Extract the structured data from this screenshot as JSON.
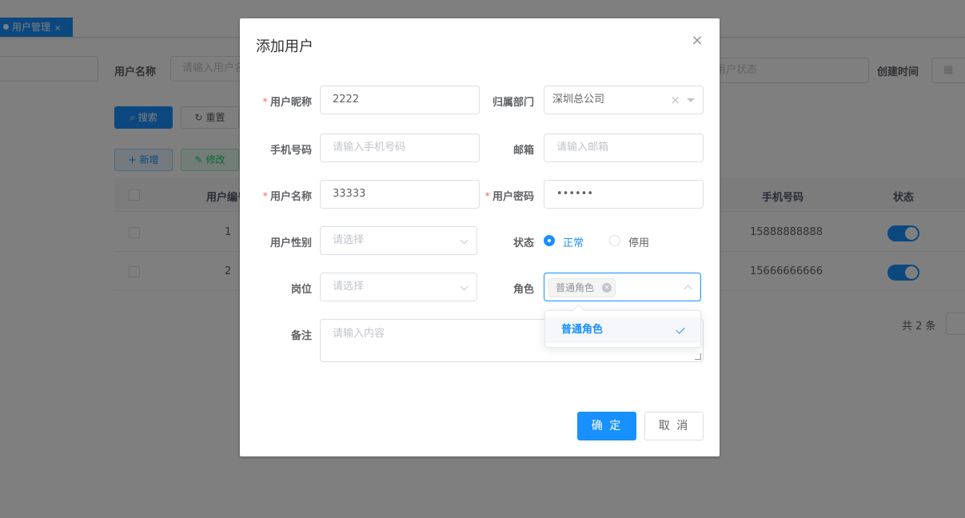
{
  "tags": {
    "active_label": "用户管理",
    "close": "×"
  },
  "query": {
    "username_label": "用户名称",
    "username_placeholder": "请输入用户名称",
    "status_placeholder": "用户状态",
    "created_label": "创建时间",
    "search_btn": "搜索",
    "reset_btn": "重置"
  },
  "toolbar": {
    "add_btn": "新增",
    "edit_btn": "修改"
  },
  "table": {
    "headers": {
      "id": "用户编号",
      "phone": "手机号码",
      "status": "状态"
    },
    "rows": [
      {
        "id": "1",
        "phone": "15888888888",
        "status_on": true
      },
      {
        "id": "2",
        "phone": "15666666666",
        "status_on": true
      }
    ]
  },
  "pagination": {
    "total": "共 2 条"
  },
  "dialog": {
    "title": "添加用户",
    "close_icon": "×",
    "fields": {
      "nickname": {
        "label": "用户昵称",
        "value": "2222",
        "required": true
      },
      "dept": {
        "label": "归属部门",
        "value": "深圳总公司"
      },
      "phone": {
        "label": "手机号码",
        "placeholder": "请输入手机号码"
      },
      "email": {
        "label": "邮箱",
        "placeholder": "请输入邮箱"
      },
      "username": {
        "label": "用户名称",
        "value": "33333",
        "required": true
      },
      "password": {
        "label": "用户密码",
        "value": "••••••",
        "required": true
      },
      "gender": {
        "label": "用户性别",
        "placeholder": "请选择"
      },
      "status": {
        "label": "状态",
        "options": [
          "正常",
          "停用"
        ],
        "selected": "正常"
      },
      "post": {
        "label": "岗位",
        "placeholder": "请选择"
      },
      "role": {
        "label": "角色",
        "selected_tag": "普通角色"
      },
      "remark": {
        "label": "备注",
        "placeholder": "请输入内容"
      }
    },
    "role_dropdown": {
      "options": [
        "普通角色"
      ],
      "selected": "普通角色"
    },
    "confirm_btn": "确 定",
    "cancel_btn": "取 消"
  },
  "colors": {
    "primary": "#1890ff",
    "required": "#f56c6c",
    "overlay": "rgba(0,0,0,0.5)"
  }
}
